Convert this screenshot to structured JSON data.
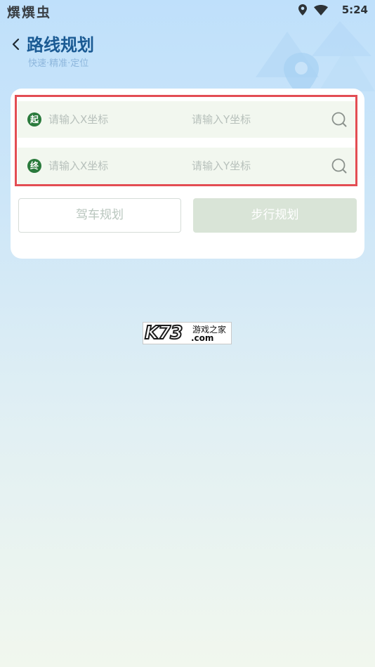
{
  "status_bar": {
    "left_text": "熼熼虫",
    "time": "5:24",
    "icons": [
      "location-icon",
      "wifi-icon",
      "battery-icon"
    ]
  },
  "header": {
    "back_icon": "chevron-left-icon",
    "title": "路线规划",
    "subtitle": "快速·精准·定位"
  },
  "form": {
    "start": {
      "badge": "起",
      "x_placeholder": "请输入X坐标",
      "y_placeholder": "请输入Y坐标",
      "x_value": "",
      "y_value": "",
      "search_icon": "search-icon"
    },
    "end": {
      "badge": "终",
      "x_placeholder": "请输入X坐标",
      "y_placeholder": "请输入Y坐标",
      "x_value": "",
      "y_value": "",
      "search_icon": "search-icon"
    }
  },
  "buttons": {
    "drive": "驾车规划",
    "walk": "步行规划"
  },
  "watermark": {
    "brand": "K73",
    "top": "游戏之家",
    "domain": ".com"
  },
  "colors": {
    "title": "#1a5a93",
    "accent_green": "#2a7a3c",
    "highlight_border": "#e34d53",
    "walk_button_bg": "#d9e4d7"
  }
}
